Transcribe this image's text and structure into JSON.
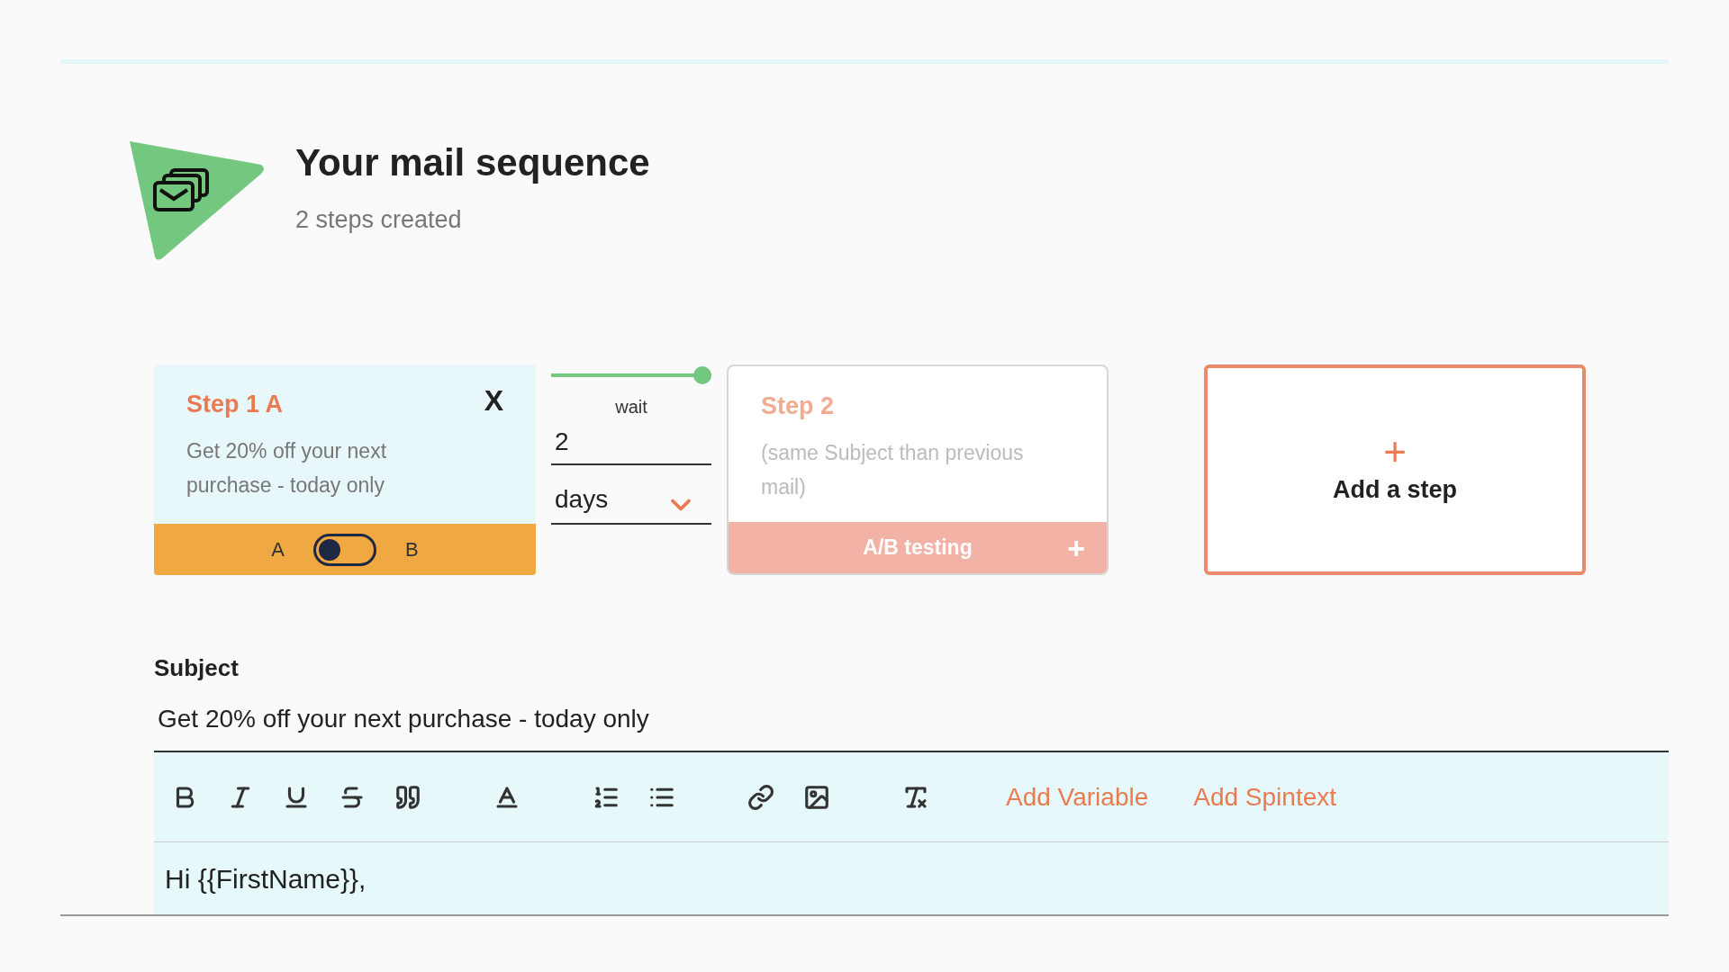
{
  "header": {
    "title": "Your mail sequence",
    "subtitle": "2 steps created"
  },
  "steps": [
    {
      "kind": "step",
      "title": "Step 1 A",
      "close": "X",
      "text": "Get 20% off your next purchase - today only",
      "selected": true,
      "toggle": {
        "left": "A",
        "right": "B",
        "on": false
      }
    },
    {
      "kind": "wait",
      "label": "wait",
      "level": 1,
      "value": "2",
      "unit": "days"
    },
    {
      "kind": "step",
      "title": "Step 2",
      "text": "(same Subject than previous mail)",
      "selected": false,
      "footer": {
        "label": "A/B testing",
        "icon": "+"
      }
    },
    {
      "kind": "add",
      "icon": "+",
      "label": "Add a step"
    }
  ],
  "subject": {
    "label": "Subject",
    "value": "Get 20% off your next purchase - today only"
  },
  "editor": {
    "actions": [
      "Add Variable",
      "Add Spintext"
    ],
    "body": "Hi {{FirstName}},"
  }
}
